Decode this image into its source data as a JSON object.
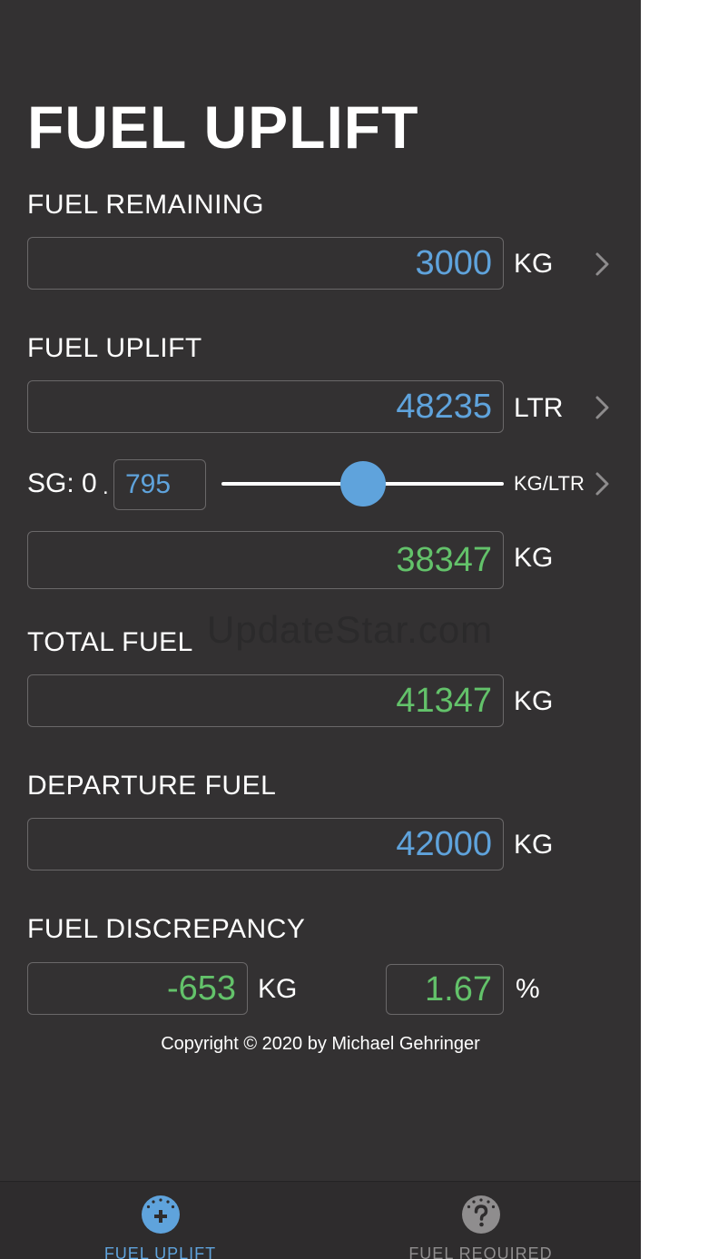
{
  "screen": {
    "title": "FUEL UPLIFT",
    "watermark": "UpdateStar.com"
  },
  "fuel_remaining": {
    "label": "FUEL REMAINING",
    "value": "3000",
    "unit": "KG"
  },
  "fuel_uplift": {
    "label": "FUEL UPLIFT",
    "value": "48235",
    "unit": "LTR"
  },
  "sg": {
    "label": "SG: 0",
    "decimal": ".",
    "value": "795",
    "unit": "KG/LTR",
    "slider_level": 0.5
  },
  "uplift_mass": {
    "value": "38347",
    "unit": "KG"
  },
  "total_fuel": {
    "label": "TOTAL FUEL",
    "value": "41347",
    "unit": "KG"
  },
  "departure_fuel": {
    "label": "DEPARTURE FUEL",
    "value": "42000",
    "unit": "KG"
  },
  "discrepancy": {
    "label": "FUEL DISCREPANCY",
    "value_kg": "-653",
    "unit_kg": "KG",
    "value_pct": "1.67",
    "unit_pct": "%"
  },
  "copyright": "Copyright © 2020 by Michael Gehringer",
  "tabs": [
    {
      "label": "FUEL UPLIFT",
      "icon": "plus-gauge-icon",
      "active": true
    },
    {
      "label": "FUEL REQUIRED",
      "icon": "question-gauge-icon",
      "active": false
    }
  ],
  "colors": {
    "background": "#333132",
    "accent_blue": "#5fa3dc",
    "result_green": "#63c26a"
  }
}
